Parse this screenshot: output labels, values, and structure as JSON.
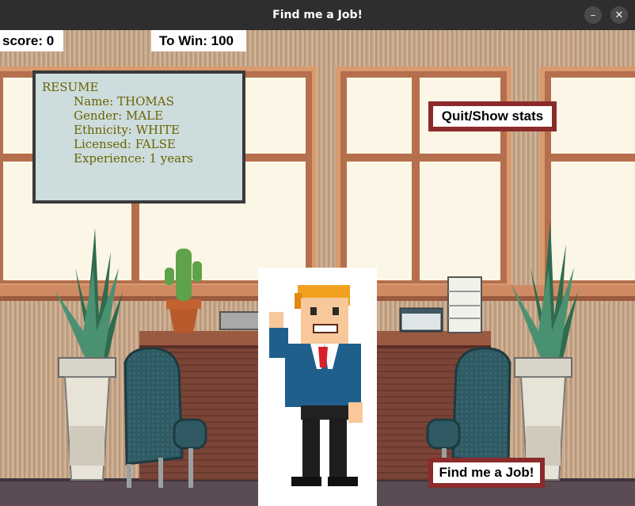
{
  "window": {
    "title": "Find me a Job!",
    "minimize_glyph": "–",
    "close_glyph": "✕"
  },
  "hud": {
    "score_text": "score: 0",
    "to_win_text": "To Win: 100"
  },
  "resume": {
    "heading": "RESUME",
    "lines": [
      "Name: THOMAS",
      "Gender: MALE",
      "Ethnicity: WHITE",
      "Licensed: FALSE",
      "Experience: 1 years"
    ]
  },
  "buttons": {
    "quit_label": "Quit/Show stats",
    "find_job_label": "Find me a Job!"
  },
  "colors": {
    "button_frame": "#8b2b2b",
    "resume_text": "#6b6300",
    "resume_bg": "#cddcdd",
    "wall": "#c9a98a"
  },
  "icons": [
    "minimize-icon",
    "close-icon",
    "cactus-icon",
    "plant-icon",
    "chair-icon",
    "desk-icon",
    "character-icon",
    "paper-stack-icon",
    "mug-icon"
  ]
}
